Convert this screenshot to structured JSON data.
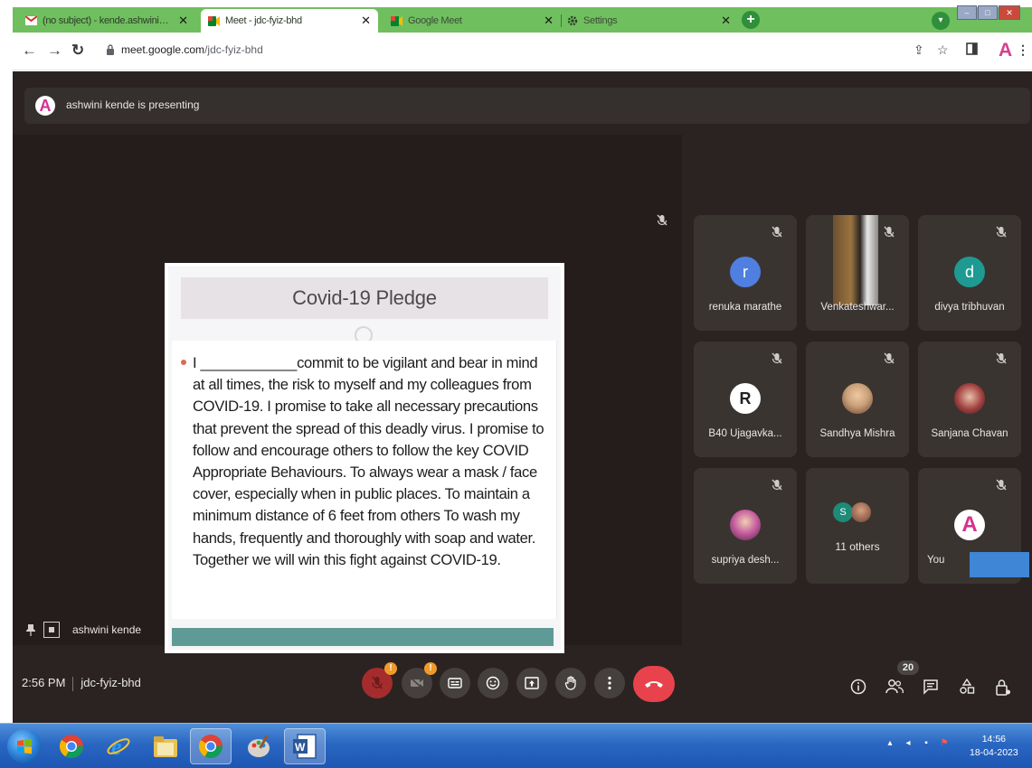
{
  "browser": {
    "tabs": [
      {
        "title": "(no subject) - kende.ashwini@gr",
        "icon": "gmail-icon"
      },
      {
        "title": "Meet - jdc-fyiz-bhd",
        "icon": "meet-icon"
      },
      {
        "title": "Google Meet",
        "icon": "meet-icon"
      },
      {
        "title": "Settings",
        "icon": "gear-icon"
      }
    ],
    "url_domain": "meet.google.com",
    "url_path": "/jdc-fyiz-bhd"
  },
  "meet": {
    "presenting_initial": "A",
    "presenting_text": "ashwini kende is presenting",
    "presenter_name": "ashwini kende",
    "slide": {
      "title": "Covid-19 Pledge",
      "body": "I ____________commit to be vigilant and bear in mind at all times, the risk to myself and my colleagues from COVID-19. I promise to take all necessary precautions that prevent the spread of this deadly virus. I promise to follow and encourage others to follow the key COVID Appropriate Behaviours. To always wear a mask / face cover, especially when in public places. To maintain a minimum distance of 6 feet from others To wash my hands, frequently and thoroughly with soap and water. Together we will win this fight against COVID-19."
    },
    "participants": [
      {
        "name": "renuka marathe",
        "initial": "r",
        "color": "#4f7fe0"
      },
      {
        "name": "Venkateshwar...",
        "initial": "",
        "color": ""
      },
      {
        "name": "divya tribhuvan",
        "initial": "d",
        "color": "#1e9a92"
      },
      {
        "name": "B40 Ujagavka...",
        "initial": "R",
        "color": "#ffffff"
      },
      {
        "name": "Sandhya Mishra",
        "initial": "",
        "color": "#c9a27b"
      },
      {
        "name": "Sanjana Chavan",
        "initial": "",
        "color": "#a04040"
      },
      {
        "name": "supriya desh...",
        "initial": "",
        "color": "#c45aa0"
      }
    ],
    "others": {
      "label": "11 others",
      "initial": "S"
    },
    "you": {
      "label": "You",
      "initial": "A"
    },
    "time": "2:56 PM",
    "meeting_code": "jdc-fyiz-bhd",
    "participant_count": "20"
  },
  "taskbar": {
    "time": "14:56",
    "date": "18-04-2023"
  },
  "colors": {
    "tab_strip": "#6fbf5e",
    "meet_bg": "#2a2321",
    "hangup": "#e8434c",
    "accent_you": "#d5318e"
  }
}
